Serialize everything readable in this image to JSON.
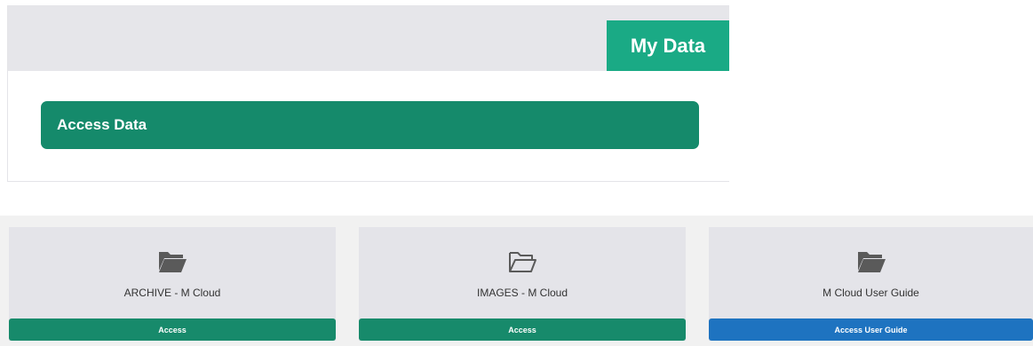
{
  "header": {
    "title": "My Data"
  },
  "access_bar": {
    "label": "Access Data"
  },
  "cards": [
    {
      "title": "ARCHIVE - M Cloud",
      "button": "Access",
      "icon": "folder-open-filled-icon",
      "button_color": "#178a6b"
    },
    {
      "title": "IMAGES - M Cloud",
      "button": "Access",
      "icon": "folder-open-outline-icon",
      "button_color": "#178a6b"
    },
    {
      "title": "M Cloud User Guide",
      "button": "Access User Guide",
      "icon": "folder-open-filled-icon",
      "button_color": "#1e73c0"
    }
  ],
  "colors": {
    "accent": "#1aaa85",
    "accent_dark": "#158a6b",
    "blue": "#1e73c0"
  }
}
